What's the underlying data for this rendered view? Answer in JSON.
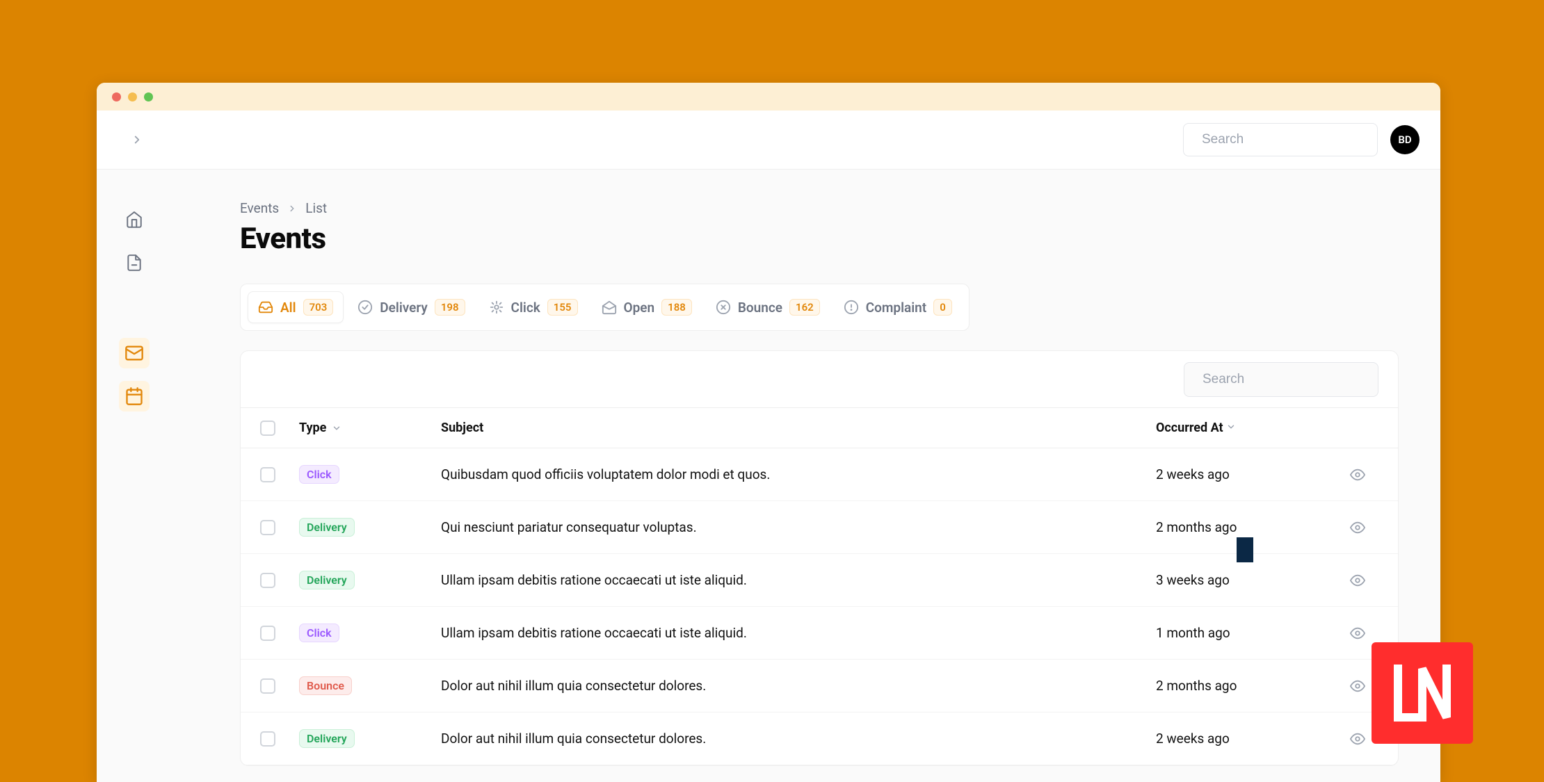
{
  "topbar": {
    "search_placeholder": "Search",
    "avatar": "BD"
  },
  "breadcrumb": {
    "root": "Events",
    "leaf": "List"
  },
  "page_title": "Events",
  "tabs": [
    {
      "label": "All",
      "count": "703"
    },
    {
      "label": "Delivery",
      "count": "198"
    },
    {
      "label": "Click",
      "count": "155"
    },
    {
      "label": "Open",
      "count": "188"
    },
    {
      "label": "Bounce",
      "count": "162"
    },
    {
      "label": "Complaint",
      "count": "0"
    }
  ],
  "card": {
    "search_placeholder": "Search",
    "columns": {
      "type": "Type",
      "subject": "Subject",
      "occurred_at": "Occurred At"
    }
  },
  "rows": [
    {
      "type": "Click",
      "type_class": "click",
      "subject": "Quibusdam quod officiis voluptatem dolor modi et quos.",
      "date": "2 weeks ago"
    },
    {
      "type": "Delivery",
      "type_class": "delivery",
      "subject": "Qui nesciunt pariatur consequatur voluptas.",
      "date": "2 months ago"
    },
    {
      "type": "Delivery",
      "type_class": "delivery",
      "subject": "Ullam ipsam debitis ratione occaecati ut iste aliquid.",
      "date": "3 weeks ago"
    },
    {
      "type": "Click",
      "type_class": "click",
      "subject": "Ullam ipsam debitis ratione occaecati ut iste aliquid.",
      "date": "1 month ago"
    },
    {
      "type": "Bounce",
      "type_class": "bounce",
      "subject": "Dolor aut nihil illum quia consectetur dolores.",
      "date": "2 months ago"
    },
    {
      "type": "Delivery",
      "type_class": "delivery",
      "subject": "Dolor aut nihil illum quia consectetur dolores.",
      "date": "2 weeks ago"
    }
  ]
}
